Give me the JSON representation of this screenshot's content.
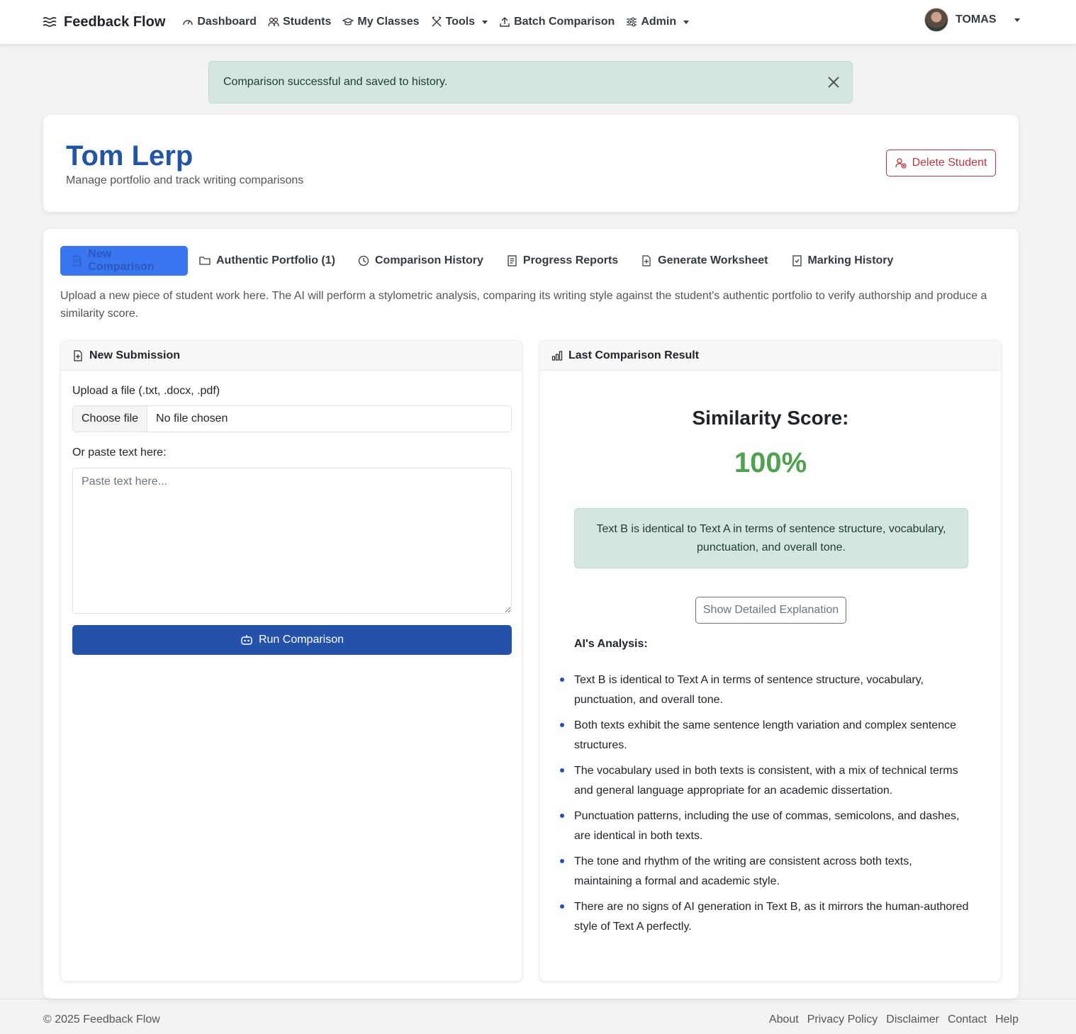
{
  "navbar": {
    "brand": "Feedback Flow",
    "items": [
      {
        "label": "Dashboard"
      },
      {
        "label": "Students"
      },
      {
        "label": "My Classes"
      },
      {
        "label": "Tools"
      },
      {
        "label": "Batch Comparison"
      },
      {
        "label": "Admin"
      }
    ],
    "user": "TOMAS"
  },
  "alert": {
    "message": "Comparison successful and saved to history."
  },
  "student": {
    "name": "Tom Lerp",
    "subtitle": "Manage portfolio and track writing comparisons",
    "delete_label": "Delete Student"
  },
  "tabs": [
    {
      "label": "New Comparison"
    },
    {
      "label": "Authentic Portfolio (1)"
    },
    {
      "label": "Comparison History"
    },
    {
      "label": "Progress Reports"
    },
    {
      "label": "Generate Worksheet"
    },
    {
      "label": "Marking History"
    }
  ],
  "intro": "Upload a new piece of student work here. The AI will perform a stylometric analysis, comparing its writing style against the student's authentic portfolio to verify authorship and produce a similarity score.",
  "submission": {
    "title": "New Submission",
    "file_label": "Upload a file (.txt, .docx, .pdf)",
    "file_button": "Choose file",
    "file_status": "No file chosen",
    "paste_label": "Or paste text here:",
    "paste_placeholder": "Paste text here...",
    "run_label": "Run Comparison"
  },
  "result": {
    "title": "Last Comparison Result",
    "score_title": "Similarity Score:",
    "score_value": "100%",
    "summary": "Text B is identical to Text A in terms of sentence structure, vocabulary, punctuation, and overall tone.",
    "explain_label": "Show Detailed Explanation",
    "analysis_title": "AI's Analysis:",
    "analysis": [
      "Text B is identical to Text A in terms of sentence structure, vocabulary, punctuation, and overall tone.",
      "Both texts exhibit the same sentence length variation and complex sentence structures.",
      "The vocabulary used in both texts is consistent, with a mix of technical terms and general language appropriate for an academic dissertation.",
      "Punctuation patterns, including the use of commas, semicolons, and dashes, are identical in both texts.",
      "The tone and rhythm of the writing are consistent across both texts, maintaining a formal and academic style.",
      "There are no signs of AI generation in Text B, as it mirrors the human-authored style of Text A perfectly."
    ]
  },
  "footer": {
    "copyright": "© 2025 Feedback Flow",
    "links": [
      "About",
      "Privacy Policy",
      "Disclaimer",
      "Contact",
      "Help"
    ]
  },
  "colors": {
    "brand_blue": "#2452a8",
    "active_tab": "#3a76f0",
    "success_bg": "#d4e7df",
    "score_green": "#4fa24f",
    "danger": "#c0343f"
  }
}
